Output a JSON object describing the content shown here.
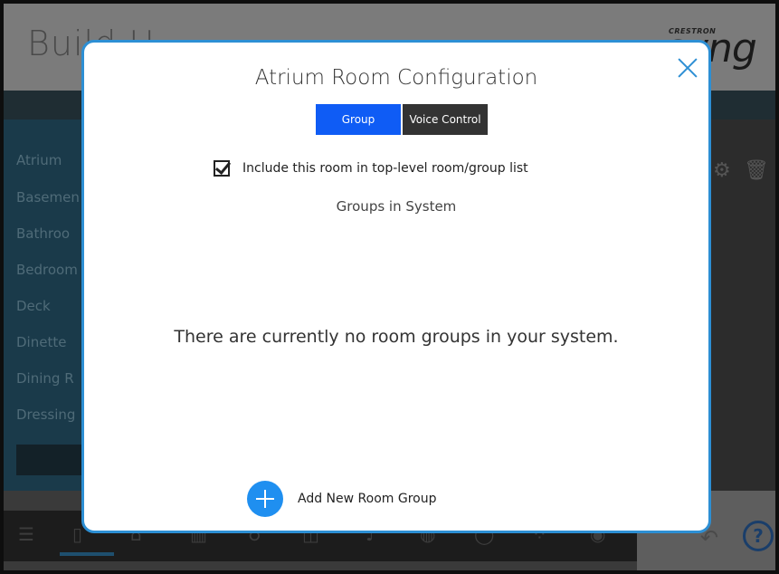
{
  "background_app": {
    "title": "Build H",
    "brand_small": "CRESTRON",
    "brand_big": "syng",
    "rooms": [
      "Atrium",
      "Basemen",
      "Bathroo",
      "Bedroom",
      "Deck",
      "Dinette",
      "Dining R",
      "Dressing"
    ]
  },
  "modal": {
    "title": "Atrium Room Configuration",
    "tabs": [
      {
        "label": "Group",
        "active": true
      },
      {
        "label": "Voice Control",
        "active": false
      }
    ],
    "checkbox": {
      "label": "Include this room in top-level room/group list",
      "checked": true
    },
    "groups_heading": "Groups in System",
    "empty_message": "There are currently no room groups in your system.",
    "add_button_label": "Add New Room Group"
  },
  "colors": {
    "accent": "#2d8fd4",
    "tab_active": "#0f5cf5",
    "tab_inactive": "#333333",
    "add_button": "#1f8ff0"
  },
  "icons": [
    "close-icon",
    "checkbox-checked-icon",
    "plus-icon",
    "settings-icon",
    "trash-icon",
    "help-icon",
    "back-icon",
    "menu-icon"
  ]
}
